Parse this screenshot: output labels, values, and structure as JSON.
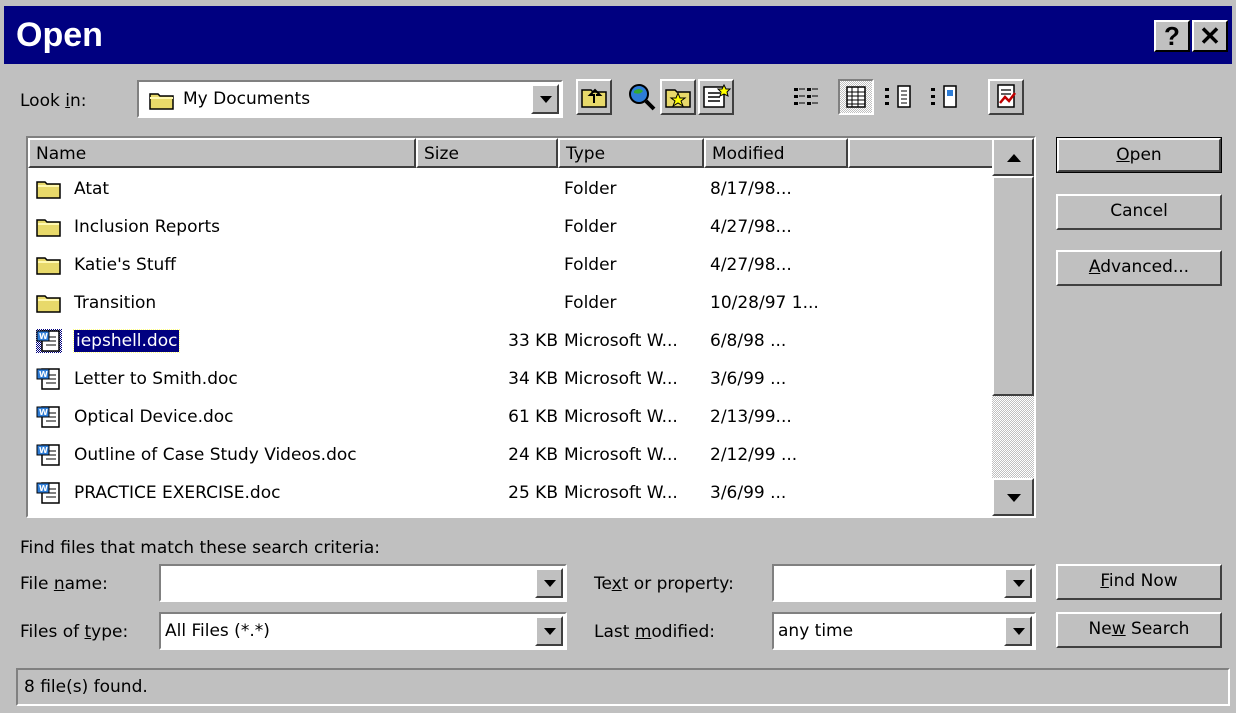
{
  "dialog": {
    "title": "Open",
    "help_glyph": "?",
    "close_glyph": "✕"
  },
  "look_in": {
    "label_pre": "Look ",
    "label_mn": "i",
    "label_post": "n:",
    "value": "My Documents",
    "icon": "folder-icon"
  },
  "toolbar": {
    "icons": [
      "up-one-level-icon",
      "search-web-icon",
      "look-in-favorites-icon",
      "add-to-favorites-icon",
      "list-view-icon",
      "details-view-icon",
      "properties-view-icon",
      "preview-view-icon",
      "commands-and-settings-icon"
    ]
  },
  "file_list": {
    "columns": [
      "Name",
      "Size",
      "Type",
      "Modified"
    ],
    "rows": [
      {
        "name": "Atat",
        "size": "",
        "type": "Folder",
        "modified": "8/17/98...",
        "icon": "folder-icon"
      },
      {
        "name": "Inclusion Reports",
        "size": "",
        "type": "Folder",
        "modified": "4/27/98...",
        "icon": "folder-icon"
      },
      {
        "name": "Katie's Stuff",
        "size": "",
        "type": "Folder",
        "modified": "4/27/98...",
        "icon": "folder-icon"
      },
      {
        "name": "Transition",
        "size": "",
        "type": "Folder",
        "modified": "10/28/97 1...",
        "icon": "folder-icon"
      },
      {
        "name": "iepshell.doc",
        "size": "33 KB",
        "type": "Microsoft W...",
        "modified": "6/8/98 ...",
        "icon": "word-doc-icon",
        "selected": true
      },
      {
        "name": "Letter to Smith.doc",
        "size": "34 KB",
        "type": "Microsoft W...",
        "modified": "3/6/99 ...",
        "icon": "word-doc-icon"
      },
      {
        "name": "Optical Device.doc",
        "size": "61 KB",
        "type": "Microsoft W...",
        "modified": "2/13/99...",
        "icon": "word-doc-icon"
      },
      {
        "name": "Outline of Case Study Videos.doc",
        "size": "24 KB",
        "type": "Microsoft W...",
        "modified": "2/12/99 ...",
        "icon": "word-doc-icon"
      },
      {
        "name": "PRACTICE EXERCISE.doc",
        "size": "25 KB",
        "type": "Microsoft W...",
        "modified": "3/6/99 ...",
        "icon": "word-doc-icon"
      }
    ]
  },
  "buttons": {
    "open": {
      "pre": "",
      "mn": "O",
      "post": "pen"
    },
    "cancel": "Cancel",
    "advanced": {
      "pre": "",
      "mn": "A",
      "post": "dvanced..."
    },
    "find_now": {
      "pre": "",
      "mn": "F",
      "post": "ind Now"
    },
    "new_search": {
      "pre": "Ne",
      "mn": "w",
      "post": " Search"
    }
  },
  "search": {
    "heading": "Find files that match these search criteria:",
    "file_name": {
      "pre": "File ",
      "mn": "n",
      "post": "ame:",
      "value": ""
    },
    "files_of_type": {
      "pre": "Files of ",
      "mn": "t",
      "post": "ype:",
      "value": "All Files (*.*)"
    },
    "text_or_property": {
      "pre": "Te",
      "mn": "x",
      "post": "t or property:",
      "value": ""
    },
    "last_modified": {
      "pre": "Last ",
      "mn": "m",
      "post": "odified:",
      "value": "any time"
    }
  },
  "status": {
    "text": "8 file(s) found."
  },
  "colors": {
    "title_bar": "#000080",
    "dialog_face": "#c0c0c0",
    "selection": "#000080"
  }
}
